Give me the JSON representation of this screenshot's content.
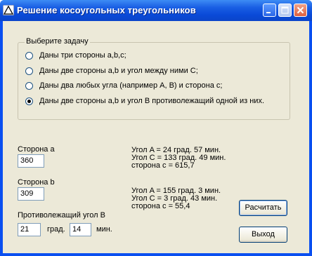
{
  "window": {
    "title": "Решение косоугольных треугольников"
  },
  "task_group": {
    "caption": "Выберите задачу",
    "options": [
      {
        "label": "Даны три стороны a,b,c;",
        "selected": false
      },
      {
        "label": "Даны две стороны a,b и угол между ними C;",
        "selected": false
      },
      {
        "label": "Даны два любых угла (например A, B) и сторона c;",
        "selected": false
      },
      {
        "label": "Даны две стороны a,b и угол B противолежащий одной из них.",
        "selected": true
      }
    ]
  },
  "inputs": {
    "side_a_label": "Сторона a",
    "side_a_value": "360",
    "side_b_label": "Сторона b",
    "side_b_value": "309",
    "angle_label": "Противолежащий угол B",
    "angle_deg_value": "21",
    "deg_unit": "град.",
    "angle_min_value": "14",
    "min_unit": "мин."
  },
  "results": {
    "solution1": [
      "Угол A = 24 град. 57 мин.",
      "Угол C = 133 град. 49 мин.",
      "сторона c = 615,7"
    ],
    "solution2": [
      "Угол A = 155 град. 3 мин.",
      "Угол C = 3 град. 43 мин.",
      "сторона c = 55,4"
    ]
  },
  "buttons": {
    "calculate": "Расчитать",
    "exit": "Выход"
  }
}
